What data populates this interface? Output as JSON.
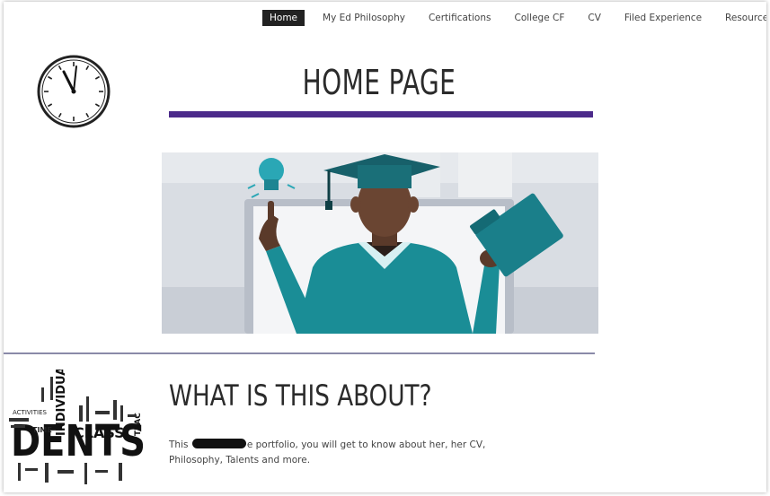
{
  "nav": {
    "items": [
      {
        "label": "Home",
        "active": true
      },
      {
        "label": "My Ed Philosophy",
        "active": false
      },
      {
        "label": "Certifications",
        "active": false
      },
      {
        "label": "College CF",
        "active": false
      },
      {
        "label": "CV",
        "active": false
      },
      {
        "label": "Filed Experience",
        "active": false
      },
      {
        "label": "Resources",
        "active": false
      }
    ]
  },
  "header": {
    "title": "HOME PAGE",
    "accent_color": "#4b2a8a"
  },
  "about": {
    "title": "WHAT IS THIS ABOUT?",
    "text_before": "This",
    "text_after": "e portfolio, you will get to know about her, her CV,",
    "text_line2": "Philosophy, Talents and more."
  },
  "wordcloud": {
    "words": [
      "INDIVIDUAL",
      "CLASS",
      "DENTS",
      "TIME",
      "ACTIVITIES",
      "TEAC"
    ]
  }
}
